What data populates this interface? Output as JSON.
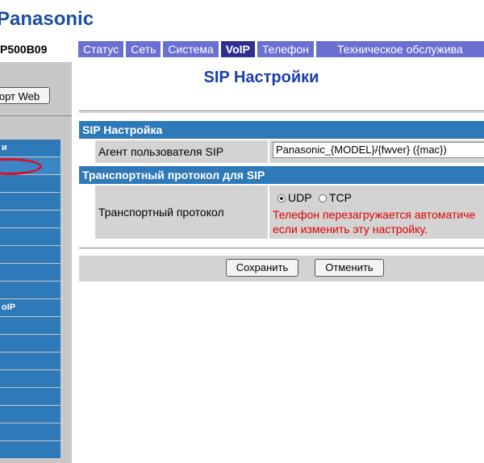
{
  "header": {
    "logo": "Panasonic",
    "model": "P500B09"
  },
  "tabs": [
    {
      "label": "Статус"
    },
    {
      "label": "Сеть"
    },
    {
      "label": "Система"
    },
    {
      "label": "VoIP"
    },
    {
      "label": "Телефон"
    },
    {
      "label": "Техническое обслужива"
    }
  ],
  "sidebar": {
    "export_button": "орт Web",
    "items": [
      {
        "label": "и"
      },
      {
        "label": ""
      },
      {
        "label": ""
      },
      {
        "label": ""
      },
      {
        "label": ""
      },
      {
        "label": ""
      },
      {
        "label": ""
      },
      {
        "label": ""
      },
      {
        "label": ""
      },
      {
        "label": "oIP"
      },
      {
        "label": ""
      },
      {
        "label": ""
      },
      {
        "label": ""
      },
      {
        "label": ""
      },
      {
        "label": ""
      },
      {
        "label": ""
      },
      {
        "label": ""
      },
      {
        "label": ""
      }
    ]
  },
  "page": {
    "title": "SIP Настройки"
  },
  "sip_section": {
    "header": "SIP Настройка",
    "user_agent_label": "Агент пользователя SIP",
    "user_agent_value": "Panasonic_{MODEL}/{fwver} ({mac})"
  },
  "transport_section": {
    "header": "Транспортный протокол для SIP",
    "protocol_label": "Транспортный протокол",
    "options": [
      {
        "label": "UDP",
        "checked": true
      },
      {
        "label": "TCP",
        "checked": false
      }
    ],
    "warning_line1": "Телефон перезагружается автоматиче",
    "warning_line2": "если изменить эту настройку."
  },
  "buttons": {
    "save": "Сохранить",
    "cancel": "Отменить"
  },
  "colors": {
    "accent": "#2e79b8",
    "tab": "#6a6fd2",
    "tab_active": "#2e2f8f",
    "title": "#1b3fa8",
    "warning": "#e00000",
    "highlight_oval": "#d8102a"
  }
}
